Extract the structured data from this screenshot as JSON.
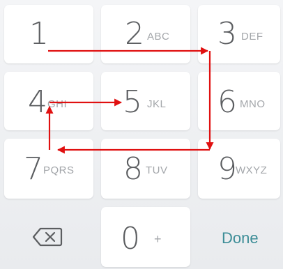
{
  "keypad": {
    "keys": [
      {
        "num": "1",
        "letters": ""
      },
      {
        "num": "2",
        "letters": "ABC"
      },
      {
        "num": "3",
        "letters": "DEF"
      },
      {
        "num": "4",
        "letters": "GHI"
      },
      {
        "num": "5",
        "letters": "JKL"
      },
      {
        "num": "6",
        "letters": "MNO"
      },
      {
        "num": "7",
        "letters": "PQRS"
      },
      {
        "num": "8",
        "letters": "TUV"
      },
      {
        "num": "9",
        "letters": "WXYZ"
      },
      {
        "num": "0",
        "letters": "+"
      }
    ],
    "done_label": "Done",
    "backspace_icon": "backspace-icon"
  },
  "overlay": {
    "path_color": "#e01010",
    "path_sequence": [
      "1",
      "3",
      "9",
      "7",
      "4",
      "5"
    ]
  }
}
